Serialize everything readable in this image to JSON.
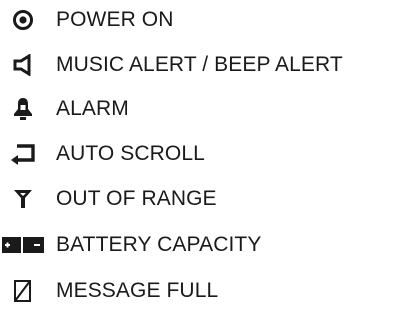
{
  "legend": {
    "items": [
      {
        "icon": "power-on-icon",
        "label": "POWER ON"
      },
      {
        "icon": "speaker-icon",
        "label": "MUSIC ALERT / BEEP ALERT"
      },
      {
        "icon": "bell-icon",
        "label": "ALARM"
      },
      {
        "icon": "return-arrow-icon",
        "label": "AUTO SCROLL"
      },
      {
        "icon": "antenna-icon",
        "label": "OUT OF RANGE"
      },
      {
        "icon": "battery-icon",
        "label": "BATTERY CAPACITY"
      },
      {
        "icon": "message-full-icon",
        "label": "MESSAGE FULL"
      }
    ]
  },
  "colors": {
    "ink": "#1a1a1a",
    "background": "#ffffff"
  }
}
